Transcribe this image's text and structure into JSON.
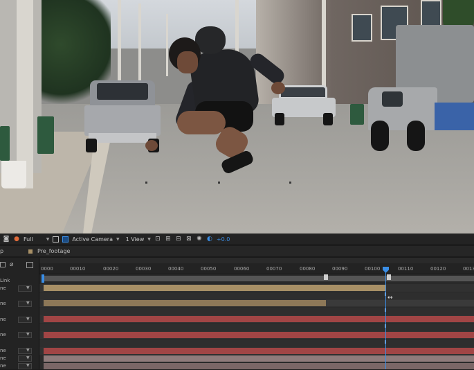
{
  "viewer": {
    "toolbar": {
      "resolution": "Full",
      "camera": "Active Camera",
      "view": "1 View",
      "exposure": "+0.0"
    },
    "icons": [
      "camera-icon",
      "color-icon",
      "grid-icon",
      "transparency-icon",
      "layout-icon",
      "fast-preview-icon",
      "flowchart-icon",
      "reset-exposure-icon"
    ]
  },
  "timeline": {
    "tabs": [
      {
        "label": "p"
      },
      {
        "label": "Pre_footage"
      }
    ],
    "ruler_labels": [
      "0000",
      "00010",
      "00020",
      "00030",
      "00040",
      "00050",
      "00060",
      "00070",
      "00080",
      "00090",
      "00100",
      "00110",
      "00120",
      "0013"
    ],
    "current_frame": 104,
    "left_labels": [
      {
        "label": "Link"
      },
      {
        "label": "ne"
      },
      {
        "label": "ne"
      },
      {
        "label": "ne"
      },
      {
        "label": "ne"
      },
      {
        "label": "ne"
      },
      {
        "label": "ne"
      },
      {
        "label": "ne"
      }
    ],
    "colors": {
      "tan_bar": "#a89066",
      "red_bar": "#a14545",
      "mauve_bar": "#8f7b7b",
      "accent": "#3a8ee6"
    }
  }
}
